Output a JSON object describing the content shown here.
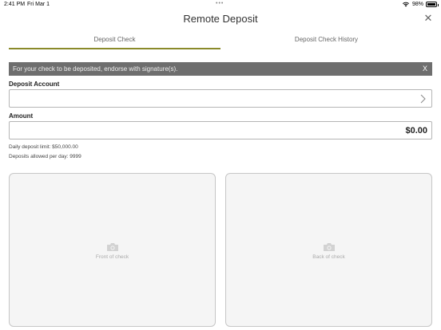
{
  "status_bar": {
    "time": "2:41 PM",
    "date": "Fri Mar 1",
    "dots": "•••",
    "battery": "98%"
  },
  "header": {
    "title": "Remote Deposit",
    "close_icon": "close-icon"
  },
  "tabs": [
    {
      "label": "Deposit Check",
      "active": true
    },
    {
      "label": "Deposit Check History",
      "active": false
    }
  ],
  "banner": {
    "message": "For your check to be deposited, endorse with signature(s).",
    "dismiss": "X"
  },
  "form": {
    "account_label": "Deposit Account",
    "account_value": "",
    "amount_label": "Amount",
    "amount_value": "$0.00"
  },
  "limits": {
    "daily_limit": "Daily deposit limit: $50,000.00",
    "per_day": "Deposits allowed per day: 9999"
  },
  "captures": {
    "front_label": "Front of check",
    "back_label": "Back of check",
    "icon": "camera-icon"
  },
  "colors": {
    "accent": "#8a8a2a",
    "banner_bg": "#6e6e6e",
    "capture_bg": "#f5f5f5"
  }
}
